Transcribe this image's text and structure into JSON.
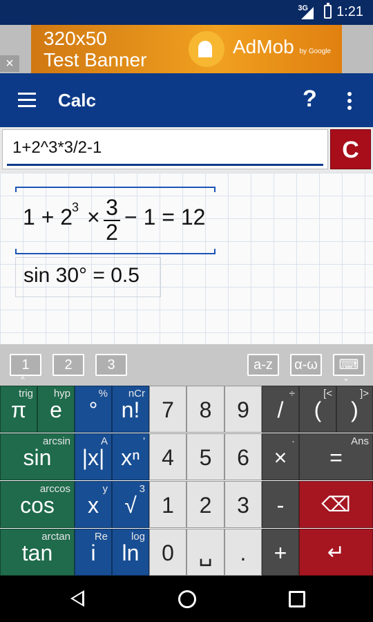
{
  "status_bar": {
    "network": "3G",
    "time": "1:21"
  },
  "ad": {
    "close": "×",
    "banner_text_line1": "320x50",
    "banner_text_line2": "Test Banner",
    "brand": "AdMob",
    "brand_sub": "by Google"
  },
  "app_bar": {
    "title": "Calc",
    "help": "?"
  },
  "input": {
    "expression": "1+2^3*3/2-1",
    "clear_label": "C"
  },
  "results": [
    {
      "lhs_a": "1 + 2",
      "exp": "3",
      "op": "×",
      "num": "3",
      "den": "2",
      "lhs_b": "− 1 = 12"
    },
    {
      "text": "sin 30° = 0.5"
    }
  ],
  "toolbar": {
    "tabs": [
      "1",
      "2",
      "3"
    ],
    "letters": "a-z",
    "greek": "α-ω",
    "up_chev": "^",
    "down_chev": "⌄"
  },
  "keys": [
    {
      "main": "π",
      "sub": "trig"
    },
    {
      "main": "e",
      "sub": "hyp"
    },
    {
      "main": "°",
      "sub": "%"
    },
    {
      "main": "n!",
      "sub": "nCr"
    },
    {
      "main": "7",
      "sub": ""
    },
    {
      "main": "8",
      "sub": ""
    },
    {
      "main": "9",
      "sub": ""
    },
    {
      "main": "/",
      "sub": "÷"
    },
    {
      "main": "(",
      "sub": "[<"
    },
    {
      "main": ")",
      "sub": "]>"
    },
    {
      "main": "sin",
      "sub": "arcsin"
    },
    {
      "main": "|x|",
      "sub": "A"
    },
    {
      "main": "xⁿ",
      "sub": "'"
    },
    {
      "main": "4",
      "sub": ""
    },
    {
      "main": "5",
      "sub": ""
    },
    {
      "main": "6",
      "sub": ""
    },
    {
      "main": "×",
      "sub": "·"
    },
    {
      "main": "=",
      "sub": "Ans"
    },
    {
      "main": "cos",
      "sub": "arccos"
    },
    {
      "main": "x",
      "sub": "y"
    },
    {
      "main": "√",
      "sub": "3"
    },
    {
      "main": "1",
      "sub": ""
    },
    {
      "main": "2",
      "sub": ""
    },
    {
      "main": "3",
      "sub": ""
    },
    {
      "main": "-",
      "sub": ""
    },
    {
      "main": "⌫",
      "sub": ""
    },
    {
      "main": "tan",
      "sub": "arctan"
    },
    {
      "main": "i",
      "sub": "Re"
    },
    {
      "main": "ln",
      "sub": "log"
    },
    {
      "main": "0",
      "sub": ""
    },
    {
      "main": "␣",
      "sub": ""
    },
    {
      "main": ".",
      "sub": "´"
    },
    {
      "main": "+",
      "sub": ""
    },
    {
      "main": "↵",
      "sub": ""
    }
  ]
}
